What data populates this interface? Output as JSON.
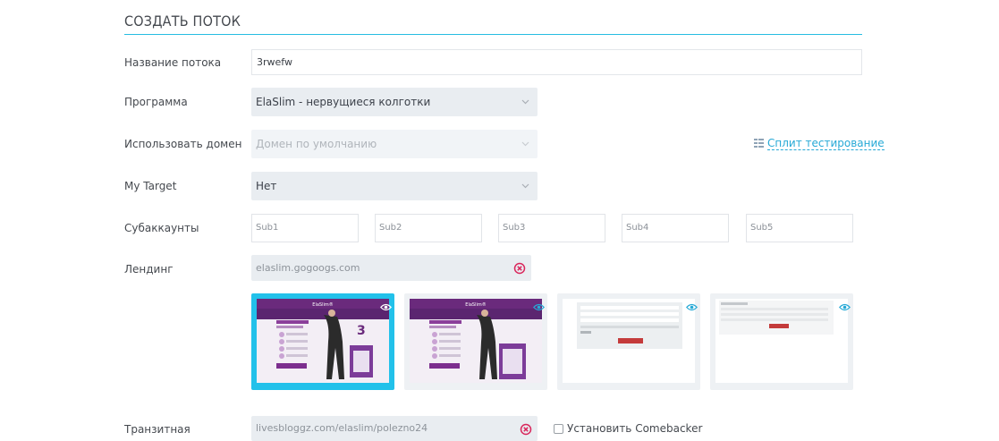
{
  "header": {
    "title": "СОЗДАТЬ ПОТОК"
  },
  "form": {
    "stream_name": {
      "label": "Название потока",
      "value": "3rwefw"
    },
    "program": {
      "label": "Программа",
      "value": "ElaSlim - нервущиеся колготки"
    },
    "domain": {
      "label": "Использовать домен",
      "placeholder": "Домен по умолчанию"
    },
    "split_test": {
      "label": "Сплит тестирование",
      "icon": "split-grid-icon"
    },
    "my_target": {
      "label": "My Target",
      "value": "Нет"
    },
    "subaccounts": {
      "label": "Субаккаунты",
      "fields": [
        "Sub1",
        "Sub2",
        "Sub3",
        "Sub4",
        "Sub5"
      ]
    },
    "landing": {
      "label": "Лендинг",
      "value": "elaslim.gogoogs.com"
    },
    "transit": {
      "label": "Транзитная",
      "value": "livesbloggz.com/elaslim/polezno24"
    },
    "comebacker": {
      "label": "Установить Comebacker",
      "checked": false
    }
  },
  "thumbnails": {
    "brand": "ElaSlim®",
    "items": [
      {
        "kind": "product",
        "selected": true
      },
      {
        "kind": "product",
        "selected": false
      },
      {
        "kind": "form",
        "selected": false
      },
      {
        "kind": "form",
        "selected": false
      }
    ]
  },
  "colors": {
    "accent": "#26bde2",
    "link": "#26a9d6",
    "danger": "#d9265b",
    "brand_purple": "#6a2a7c"
  }
}
